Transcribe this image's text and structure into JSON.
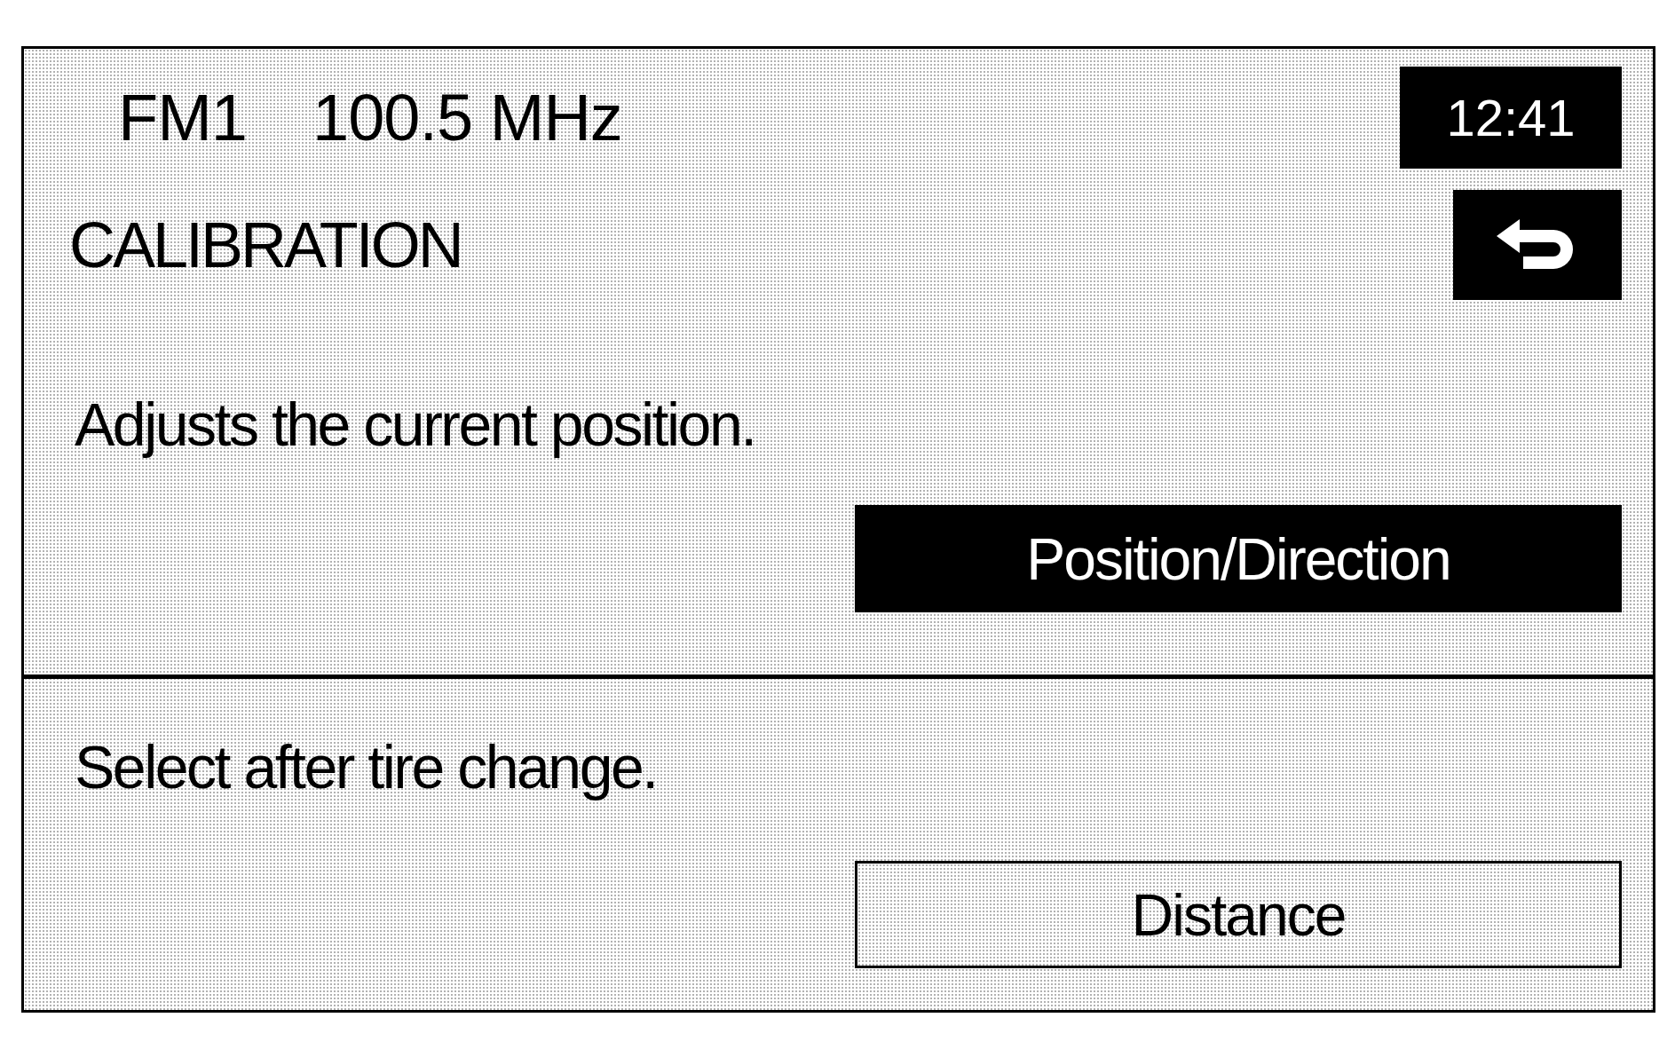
{
  "header": {
    "band": "FM1",
    "frequency": "100.5 MHz",
    "clock": "12:41"
  },
  "title": "CALIBRATION",
  "options": [
    {
      "description": "Adjusts the current position.",
      "button": "Position/Direction",
      "selected": true
    },
    {
      "description": "Select after tire change.",
      "button": "Distance",
      "selected": false
    }
  ]
}
